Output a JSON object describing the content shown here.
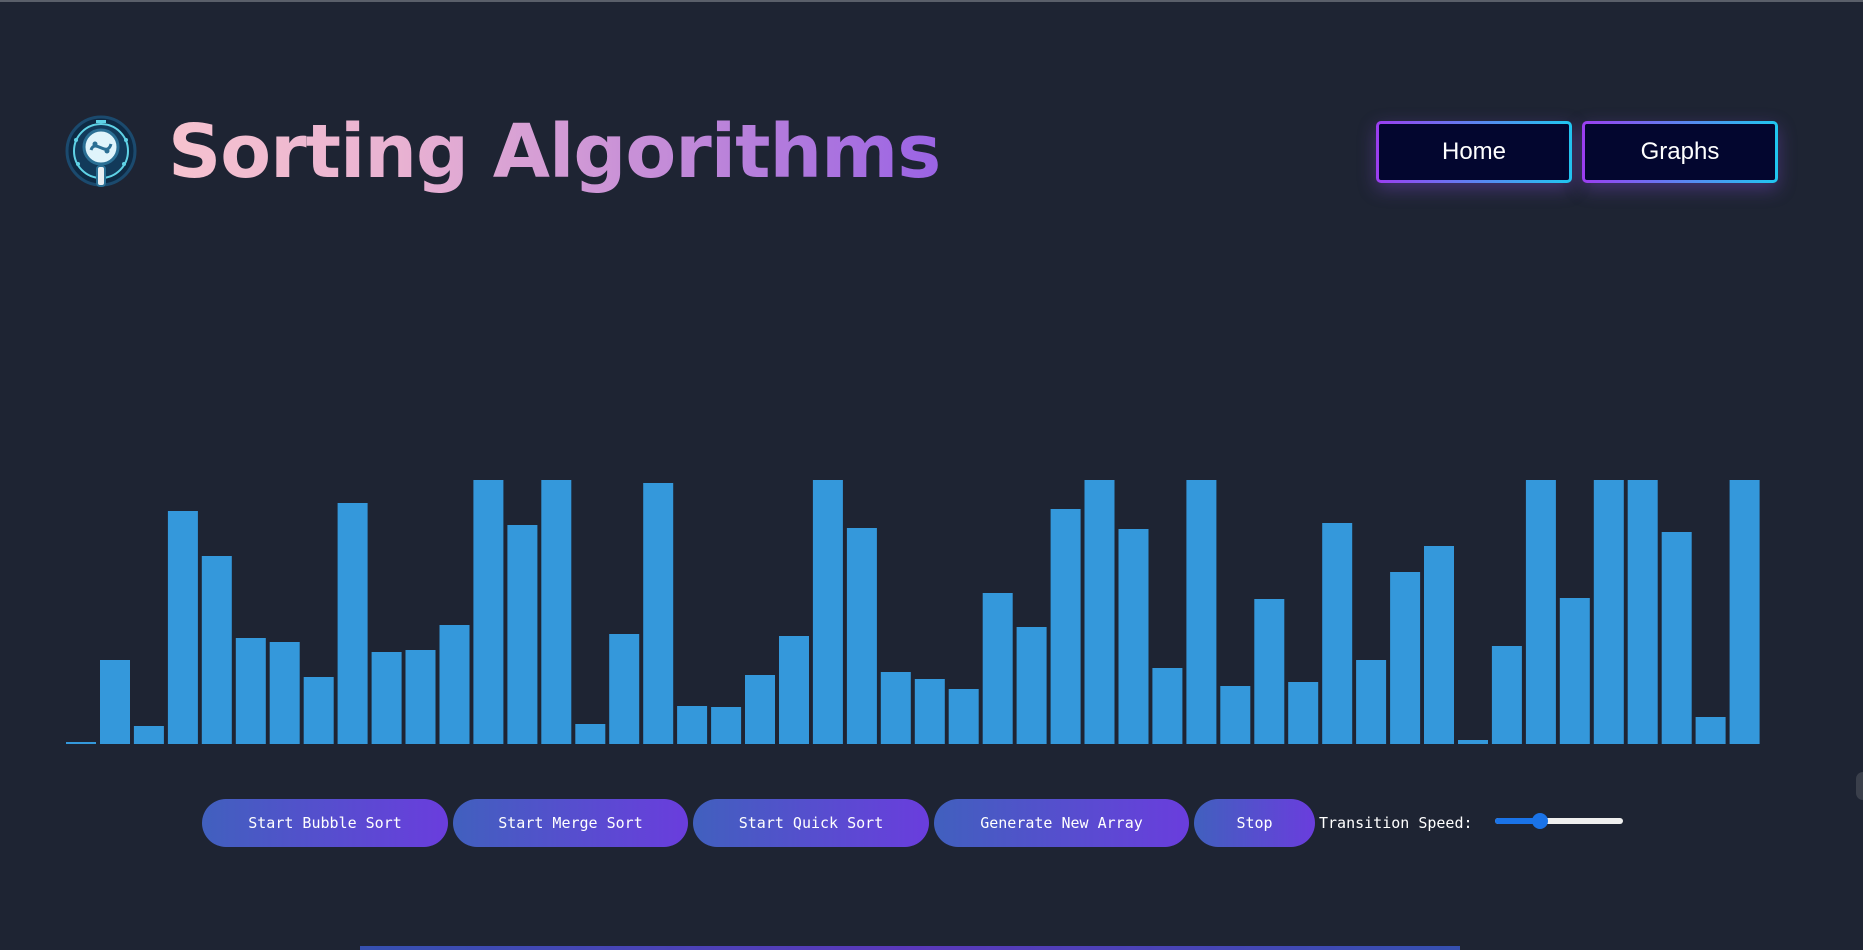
{
  "header": {
    "title": "Sorting Algorithms",
    "logo_icon": "magnifier-logo-icon"
  },
  "nav": {
    "home_label": "Home",
    "graphs_label": "Graphs"
  },
  "chart_data": {
    "type": "bar",
    "values": [
      2,
      84,
      18,
      233,
      188,
      106,
      102,
      67,
      241,
      92,
      94,
      119,
      264,
      219,
      264,
      20,
      110,
      261,
      38,
      37,
      69,
      108,
      264,
      216,
      72,
      65,
      55,
      151,
      117,
      235,
      264,
      215,
      76,
      264,
      58,
      145,
      62,
      221,
      84,
      172,
      198,
      4,
      98,
      264,
      146,
      264,
      264,
      212,
      27,
      264
    ],
    "ylim": [
      0,
      264
    ],
    "bar_color": "#3498db"
  },
  "controls": {
    "bubble_label": "Start Bubble Sort",
    "merge_label": "Start Merge Sort",
    "quick_label": "Start Quick Sort",
    "generate_label": "Generate New Array",
    "stop_label": "Stop",
    "speed_label": "Transition Speed:",
    "speed_value": 0.33
  },
  "colors": {
    "background": "#1e2433",
    "button_gradient_start": "#4160be",
    "button_gradient_end": "#6a3ddd",
    "nav_background": "#03062f",
    "slider_accent": "#1a73e8"
  }
}
